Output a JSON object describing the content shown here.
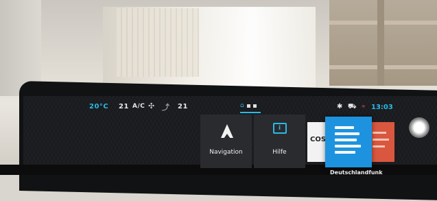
{
  "status_bar": {
    "driver_temp": "20°C",
    "fan_level": "21",
    "ac_label": "A/C",
    "passenger_temp": "21",
    "clock": "13:03",
    "icons": [
      "fan-icon",
      "seat-airflow-icon",
      "bluetooth-icon",
      "car-icon",
      "location-icon"
    ]
  },
  "pager": {
    "pages": 3,
    "active": 0
  },
  "tiles": {
    "navigation": {
      "label": "Navigation",
      "icon": "navigation-arrow-icon"
    },
    "help": {
      "label": "Hilfe",
      "icon": "book-info-icon"
    }
  },
  "radio": {
    "left_station_text": "COSA",
    "selected_station": "Deutschlandfunk"
  },
  "colors": {
    "accent": "#2bb9e6",
    "radio_tile": "#1d93e0",
    "screen_bg": "#1a1b1e"
  }
}
